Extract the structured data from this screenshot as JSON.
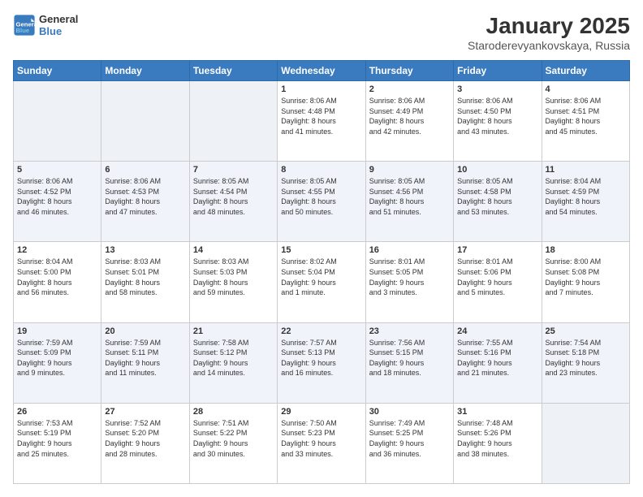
{
  "logo": {
    "line1": "General",
    "line2": "Blue"
  },
  "header": {
    "month": "January 2025",
    "location": "Staroderevyankovskaya, Russia"
  },
  "weekdays": [
    "Sunday",
    "Monday",
    "Tuesday",
    "Wednesday",
    "Thursday",
    "Friday",
    "Saturday"
  ],
  "weeks": [
    [
      {
        "day": "",
        "info": ""
      },
      {
        "day": "",
        "info": ""
      },
      {
        "day": "",
        "info": ""
      },
      {
        "day": "1",
        "info": "Sunrise: 8:06 AM\nSunset: 4:48 PM\nDaylight: 8 hours\nand 41 minutes."
      },
      {
        "day": "2",
        "info": "Sunrise: 8:06 AM\nSunset: 4:49 PM\nDaylight: 8 hours\nand 42 minutes."
      },
      {
        "day": "3",
        "info": "Sunrise: 8:06 AM\nSunset: 4:50 PM\nDaylight: 8 hours\nand 43 minutes."
      },
      {
        "day": "4",
        "info": "Sunrise: 8:06 AM\nSunset: 4:51 PM\nDaylight: 8 hours\nand 45 minutes."
      }
    ],
    [
      {
        "day": "5",
        "info": "Sunrise: 8:06 AM\nSunset: 4:52 PM\nDaylight: 8 hours\nand 46 minutes."
      },
      {
        "day": "6",
        "info": "Sunrise: 8:06 AM\nSunset: 4:53 PM\nDaylight: 8 hours\nand 47 minutes."
      },
      {
        "day": "7",
        "info": "Sunrise: 8:05 AM\nSunset: 4:54 PM\nDaylight: 8 hours\nand 48 minutes."
      },
      {
        "day": "8",
        "info": "Sunrise: 8:05 AM\nSunset: 4:55 PM\nDaylight: 8 hours\nand 50 minutes."
      },
      {
        "day": "9",
        "info": "Sunrise: 8:05 AM\nSunset: 4:56 PM\nDaylight: 8 hours\nand 51 minutes."
      },
      {
        "day": "10",
        "info": "Sunrise: 8:05 AM\nSunset: 4:58 PM\nDaylight: 8 hours\nand 53 minutes."
      },
      {
        "day": "11",
        "info": "Sunrise: 8:04 AM\nSunset: 4:59 PM\nDaylight: 8 hours\nand 54 minutes."
      }
    ],
    [
      {
        "day": "12",
        "info": "Sunrise: 8:04 AM\nSunset: 5:00 PM\nDaylight: 8 hours\nand 56 minutes."
      },
      {
        "day": "13",
        "info": "Sunrise: 8:03 AM\nSunset: 5:01 PM\nDaylight: 8 hours\nand 58 minutes."
      },
      {
        "day": "14",
        "info": "Sunrise: 8:03 AM\nSunset: 5:03 PM\nDaylight: 8 hours\nand 59 minutes."
      },
      {
        "day": "15",
        "info": "Sunrise: 8:02 AM\nSunset: 5:04 PM\nDaylight: 9 hours\nand 1 minute."
      },
      {
        "day": "16",
        "info": "Sunrise: 8:01 AM\nSunset: 5:05 PM\nDaylight: 9 hours\nand 3 minutes."
      },
      {
        "day": "17",
        "info": "Sunrise: 8:01 AM\nSunset: 5:06 PM\nDaylight: 9 hours\nand 5 minutes."
      },
      {
        "day": "18",
        "info": "Sunrise: 8:00 AM\nSunset: 5:08 PM\nDaylight: 9 hours\nand 7 minutes."
      }
    ],
    [
      {
        "day": "19",
        "info": "Sunrise: 7:59 AM\nSunset: 5:09 PM\nDaylight: 9 hours\nand 9 minutes."
      },
      {
        "day": "20",
        "info": "Sunrise: 7:59 AM\nSunset: 5:11 PM\nDaylight: 9 hours\nand 11 minutes."
      },
      {
        "day": "21",
        "info": "Sunrise: 7:58 AM\nSunset: 5:12 PM\nDaylight: 9 hours\nand 14 minutes."
      },
      {
        "day": "22",
        "info": "Sunrise: 7:57 AM\nSunset: 5:13 PM\nDaylight: 9 hours\nand 16 minutes."
      },
      {
        "day": "23",
        "info": "Sunrise: 7:56 AM\nSunset: 5:15 PM\nDaylight: 9 hours\nand 18 minutes."
      },
      {
        "day": "24",
        "info": "Sunrise: 7:55 AM\nSunset: 5:16 PM\nDaylight: 9 hours\nand 21 minutes."
      },
      {
        "day": "25",
        "info": "Sunrise: 7:54 AM\nSunset: 5:18 PM\nDaylight: 9 hours\nand 23 minutes."
      }
    ],
    [
      {
        "day": "26",
        "info": "Sunrise: 7:53 AM\nSunset: 5:19 PM\nDaylight: 9 hours\nand 25 minutes."
      },
      {
        "day": "27",
        "info": "Sunrise: 7:52 AM\nSunset: 5:20 PM\nDaylight: 9 hours\nand 28 minutes."
      },
      {
        "day": "28",
        "info": "Sunrise: 7:51 AM\nSunset: 5:22 PM\nDaylight: 9 hours\nand 30 minutes."
      },
      {
        "day": "29",
        "info": "Sunrise: 7:50 AM\nSunset: 5:23 PM\nDaylight: 9 hours\nand 33 minutes."
      },
      {
        "day": "30",
        "info": "Sunrise: 7:49 AM\nSunset: 5:25 PM\nDaylight: 9 hours\nand 36 minutes."
      },
      {
        "day": "31",
        "info": "Sunrise: 7:48 AM\nSunset: 5:26 PM\nDaylight: 9 hours\nand 38 minutes."
      },
      {
        "day": "",
        "info": ""
      }
    ]
  ]
}
